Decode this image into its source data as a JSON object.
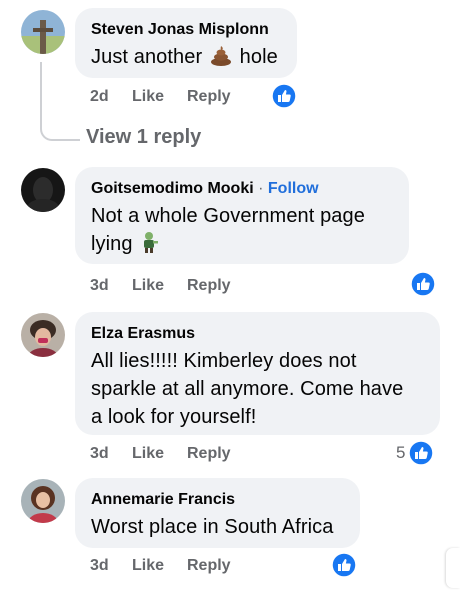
{
  "comments": [
    {
      "author": "Steven Jonas Misplonn",
      "text_before": "Just another",
      "emoji": "poop-emoji",
      "text_after": "hole",
      "time": "2d",
      "like": "Like",
      "reply": "Reply",
      "view_replies": "View 1 reply"
    },
    {
      "author": "Goitsemodimo Mooki",
      "separator": "·",
      "follow": "Follow",
      "line1": "Not a whole Government page",
      "line2": "lying",
      "emoji": "zombie-emoji",
      "time": "3d",
      "like": "Like",
      "reply": "Reply"
    },
    {
      "author": "Elza Erasmus",
      "line1": "All lies!!!!! Kimberley does not",
      "line2": "sparkle at all anymore. Come have",
      "line3": "a look for yourself!",
      "time": "3d",
      "like": "Like",
      "reply": "Reply",
      "reaction_count": "5"
    },
    {
      "author": "Annemarie Francis",
      "text": "Worst place in South Africa",
      "time": "3d",
      "like": "Like",
      "reply": "Reply"
    }
  ],
  "colors": {
    "like_blue": "#1877f2",
    "link_blue": "#216fdb",
    "bubble": "#f0f2f5",
    "muted": "#65676b"
  }
}
